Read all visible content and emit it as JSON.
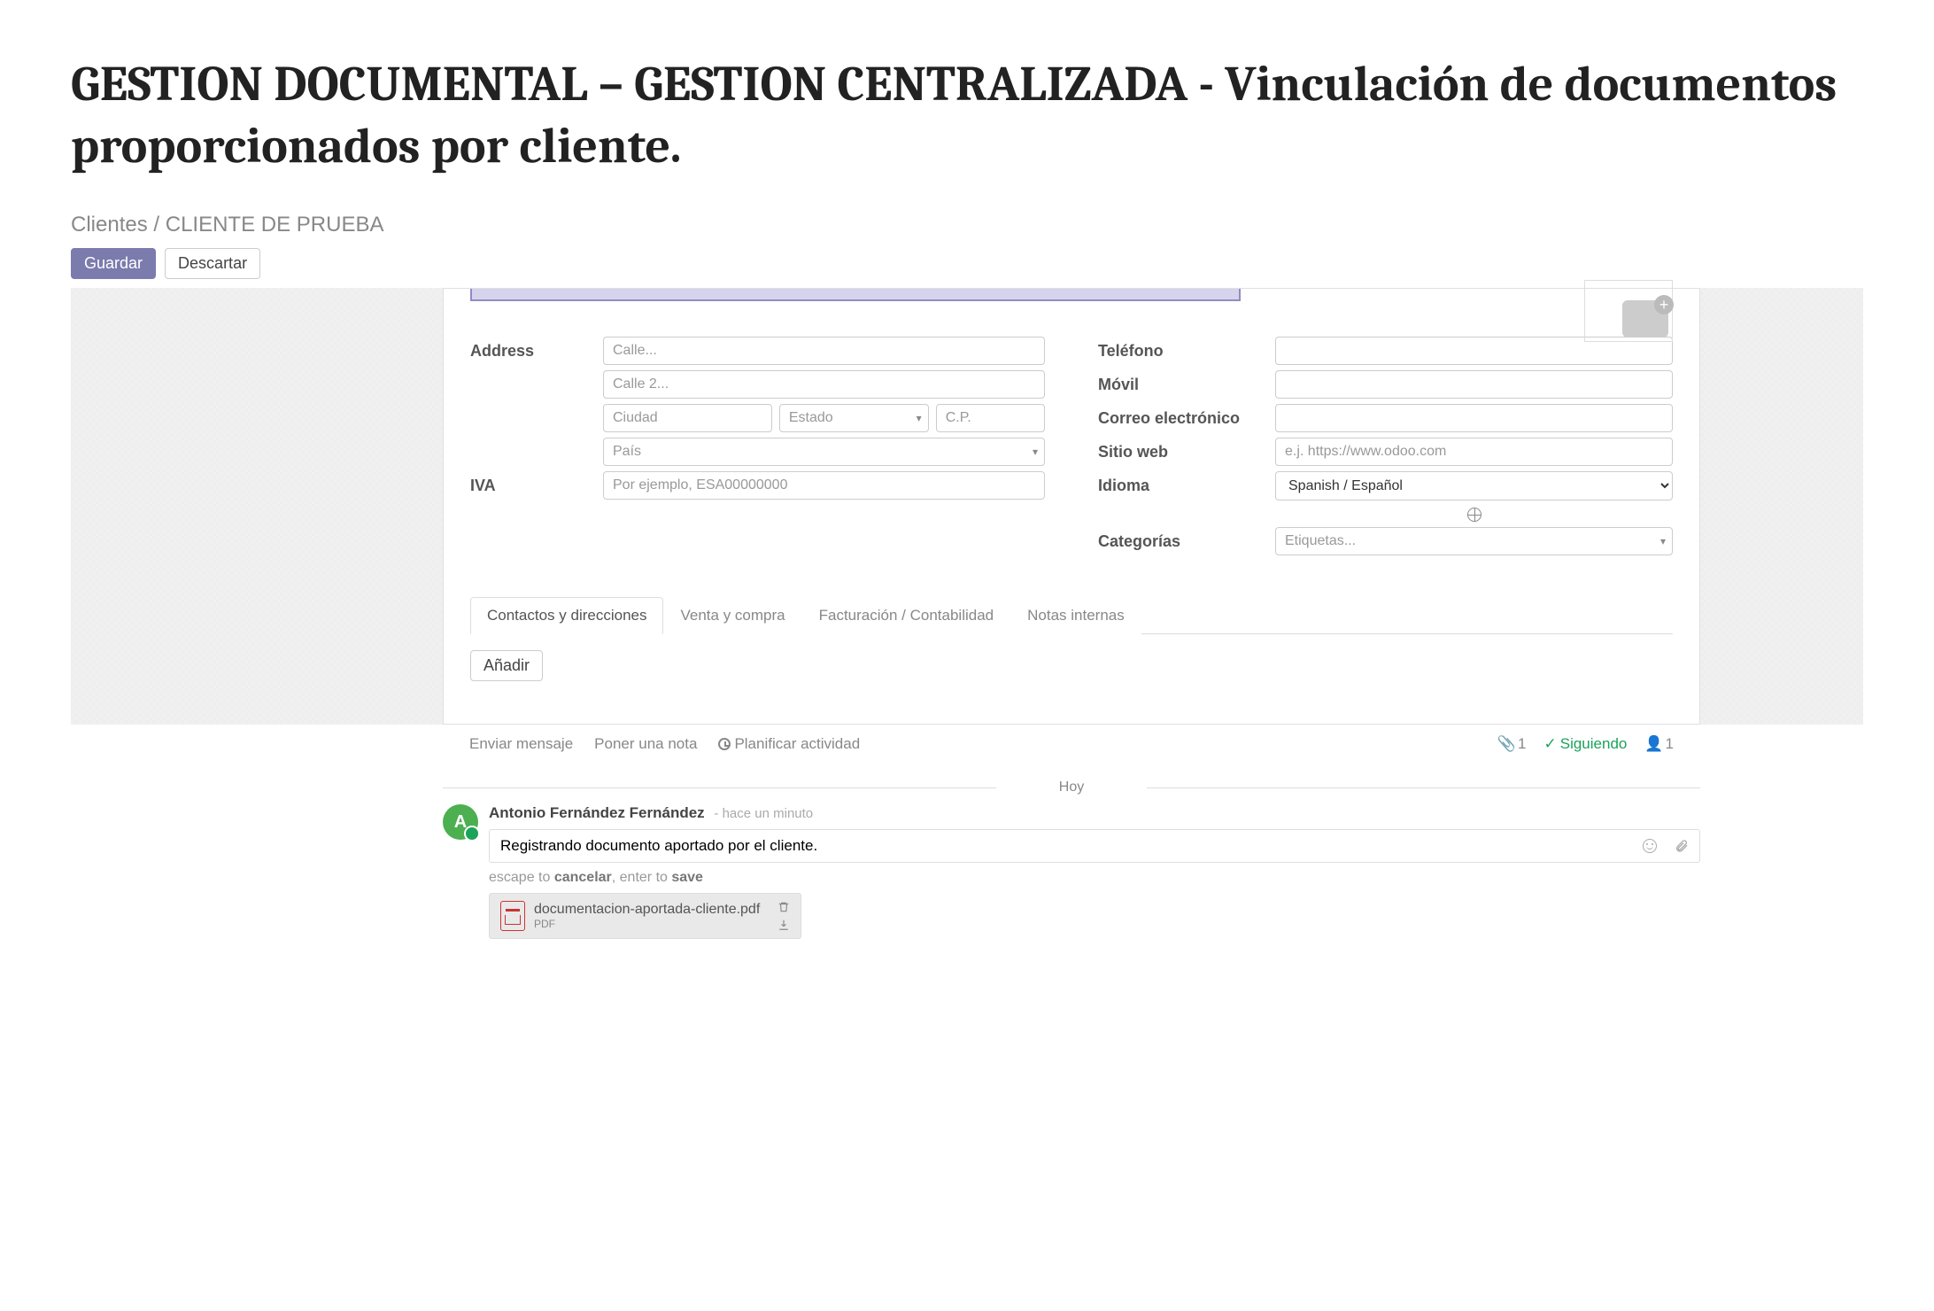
{
  "doc_title": "GESTION DOCUMENTAL – GESTION CENTRALIZADA - Vinculación de documentos proporcionados por cliente.",
  "breadcrumb": {
    "root": "Clientes",
    "sep": "/",
    "current": "CLIENTE DE PRUEBA"
  },
  "buttons": {
    "save": "Guardar",
    "discard": "Descartar",
    "add": "Añadir"
  },
  "form": {
    "labels": {
      "address": "Address",
      "iva": "IVA",
      "phone": "Teléfono",
      "mobile": "Móvil",
      "email": "Correo electrónico",
      "website": "Sitio web",
      "language": "Idioma",
      "categories": "Categorías"
    },
    "placeholders": {
      "street": "Calle...",
      "street2": "Calle 2...",
      "city": "Ciudad",
      "state": "Estado",
      "zip": "C.P.",
      "country": "País",
      "vat": "Por ejemplo, ESA00000000",
      "website": "e.j. https://www.odoo.com",
      "tags": "Etiquetas..."
    },
    "values": {
      "language": "Spanish / Español"
    }
  },
  "tabs": [
    "Contactos y direcciones",
    "Venta y compra",
    "Facturación / Contabilidad",
    "Notas internas"
  ],
  "chatter": {
    "actions": {
      "send": "Enviar mensaje",
      "note": "Poner una nota",
      "schedule": "Planificar actividad"
    },
    "attachment_count": "1",
    "following_label": "Siguiendo",
    "follower_count": "1",
    "today": "Hoy",
    "author": "Antonio Fernández Fernández",
    "ago": "- hace un minuto",
    "note_text": "Registrando documento aportado por el cliente.",
    "help_prefix": "escape to ",
    "help_cancel": "cancelar",
    "help_mid": ", enter to ",
    "help_save": "save",
    "att_name": "documentacion-aportada-cliente.pdf",
    "att_type": "PDF"
  }
}
